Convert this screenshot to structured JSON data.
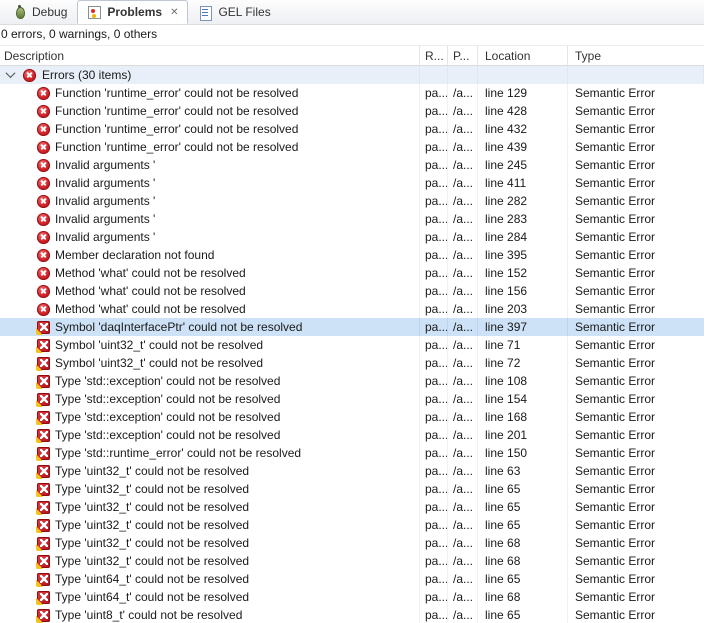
{
  "tabs": [
    {
      "id": "debug",
      "label": "Debug",
      "icon": "debug-icon",
      "active": false
    },
    {
      "id": "problems",
      "label": "Problems",
      "icon": "problems-icon",
      "active": true,
      "close_glyph": "✕"
    },
    {
      "id": "gel-files",
      "label": "GEL Files",
      "icon": "gel-files-icon",
      "active": false
    }
  ],
  "summary": "0 errors, 0 warnings, 0 others",
  "colors": {
    "error_red": "#c8191f",
    "marker_yellow": "#f6c21e",
    "selection_blue": "#cde2f6",
    "group_band": "#e9eff8"
  },
  "table": {
    "columns": [
      "Description",
      "R...",
      "P...",
      "Location",
      "Type"
    ],
    "group_label": "Errors (30 items)",
    "rows": [
      {
        "icon": "error",
        "description": "Function 'runtime_error' could not be resolved",
        "resource": "pa...",
        "path": "/a...",
        "location": "line 129",
        "type": "Semantic Error",
        "selected": false
      },
      {
        "icon": "error",
        "description": "Function 'runtime_error' could not be resolved",
        "resource": "pa...",
        "path": "/a...",
        "location": "line 428",
        "type": "Semantic Error",
        "selected": false
      },
      {
        "icon": "error",
        "description": "Function 'runtime_error' could not be resolved",
        "resource": "pa...",
        "path": "/a...",
        "location": "line 432",
        "type": "Semantic Error",
        "selected": false
      },
      {
        "icon": "error",
        "description": "Function 'runtime_error' could not be resolved",
        "resource": "pa...",
        "path": "/a...",
        "location": "line 439",
        "type": "Semantic Error",
        "selected": false
      },
      {
        "icon": "error",
        "description": "Invalid arguments '",
        "resource": "pa...",
        "path": "/a...",
        "location": "line 245",
        "type": "Semantic Error",
        "selected": false
      },
      {
        "icon": "error",
        "description": "Invalid arguments '",
        "resource": "pa...",
        "path": "/a...",
        "location": "line 411",
        "type": "Semantic Error",
        "selected": false
      },
      {
        "icon": "error",
        "description": "Invalid arguments '",
        "resource": "pa...",
        "path": "/a...",
        "location": "line 282",
        "type": "Semantic Error",
        "selected": false
      },
      {
        "icon": "error",
        "description": "Invalid arguments '",
        "resource": "pa...",
        "path": "/a...",
        "location": "line 283",
        "type": "Semantic Error",
        "selected": false
      },
      {
        "icon": "error",
        "description": "Invalid arguments '",
        "resource": "pa...",
        "path": "/a...",
        "location": "line 284",
        "type": "Semantic Error",
        "selected": false
      },
      {
        "icon": "error",
        "description": "Member declaration not found",
        "resource": "pa...",
        "path": "/a...",
        "location": "line 395",
        "type": "Semantic Error",
        "selected": false
      },
      {
        "icon": "error",
        "description": "Method 'what' could not be resolved",
        "resource": "pa...",
        "path": "/a...",
        "location": "line 152",
        "type": "Semantic Error",
        "selected": false
      },
      {
        "icon": "error",
        "description": "Method 'what' could not be resolved",
        "resource": "pa...",
        "path": "/a...",
        "location": "line 156",
        "type": "Semantic Error",
        "selected": false
      },
      {
        "icon": "error",
        "description": "Method 'what' could not be resolved",
        "resource": "pa...",
        "path": "/a...",
        "location": "line 203",
        "type": "Semantic Error",
        "selected": false
      },
      {
        "icon": "semantic",
        "description": "Symbol 'daqInterfacePtr' could not be resolved",
        "resource": "pa...",
        "path": "/a...",
        "location": "line 397",
        "type": "Semantic Error",
        "selected": true
      },
      {
        "icon": "semantic",
        "description": "Symbol 'uint32_t' could not be resolved",
        "resource": "pa...",
        "path": "/a...",
        "location": "line 71",
        "type": "Semantic Error",
        "selected": false
      },
      {
        "icon": "semantic",
        "description": "Symbol 'uint32_t' could not be resolved",
        "resource": "pa...",
        "path": "/a...",
        "location": "line 72",
        "type": "Semantic Error",
        "selected": false
      },
      {
        "icon": "semantic",
        "description": "Type 'std::exception' could not be resolved",
        "resource": "pa...",
        "path": "/a...",
        "location": "line 108",
        "type": "Semantic Error",
        "selected": false
      },
      {
        "icon": "semantic",
        "description": "Type 'std::exception' could not be resolved",
        "resource": "pa...",
        "path": "/a...",
        "location": "line 154",
        "type": "Semantic Error",
        "selected": false
      },
      {
        "icon": "semantic",
        "description": "Type 'std::exception' could not be resolved",
        "resource": "pa...",
        "path": "/a...",
        "location": "line 168",
        "type": "Semantic Error",
        "selected": false
      },
      {
        "icon": "semantic",
        "description": "Type 'std::exception' could not be resolved",
        "resource": "pa...",
        "path": "/a...",
        "location": "line 201",
        "type": "Semantic Error",
        "selected": false
      },
      {
        "icon": "semantic",
        "description": "Type 'std::runtime_error' could not be resolved",
        "resource": "pa...",
        "path": "/a...",
        "location": "line 150",
        "type": "Semantic Error",
        "selected": false
      },
      {
        "icon": "semantic",
        "description": "Type 'uint32_t' could not be resolved",
        "resource": "pa...",
        "path": "/a...",
        "location": "line 63",
        "type": "Semantic Error",
        "selected": false
      },
      {
        "icon": "semantic",
        "description": "Type 'uint32_t' could not be resolved",
        "resource": "pa...",
        "path": "/a...",
        "location": "line 65",
        "type": "Semantic Error",
        "selected": false
      },
      {
        "icon": "semantic",
        "description": "Type 'uint32_t' could not be resolved",
        "resource": "pa...",
        "path": "/a...",
        "location": "line 65",
        "type": "Semantic Error",
        "selected": false
      },
      {
        "icon": "semantic",
        "description": "Type 'uint32_t' could not be resolved",
        "resource": "pa...",
        "path": "/a...",
        "location": "line 65",
        "type": "Semantic Error",
        "selected": false
      },
      {
        "icon": "semantic",
        "description": "Type 'uint32_t' could not be resolved",
        "resource": "pa...",
        "path": "/a...",
        "location": "line 68",
        "type": "Semantic Error",
        "selected": false
      },
      {
        "icon": "semantic",
        "description": "Type 'uint32_t' could not be resolved",
        "resource": "pa...",
        "path": "/a...",
        "location": "line 68",
        "type": "Semantic Error",
        "selected": false
      },
      {
        "icon": "semantic",
        "description": "Type 'uint64_t' could not be resolved",
        "resource": "pa...",
        "path": "/a...",
        "location": "line 65",
        "type": "Semantic Error",
        "selected": false
      },
      {
        "icon": "semantic",
        "description": "Type 'uint64_t' could not be resolved",
        "resource": "pa...",
        "path": "/a...",
        "location": "line 68",
        "type": "Semantic Error",
        "selected": false
      },
      {
        "icon": "semantic",
        "description": "Type 'uint8_t' could not be resolved",
        "resource": "pa...",
        "path": "/a...",
        "location": "line 65",
        "type": "Semantic Error",
        "selected": false
      }
    ]
  }
}
